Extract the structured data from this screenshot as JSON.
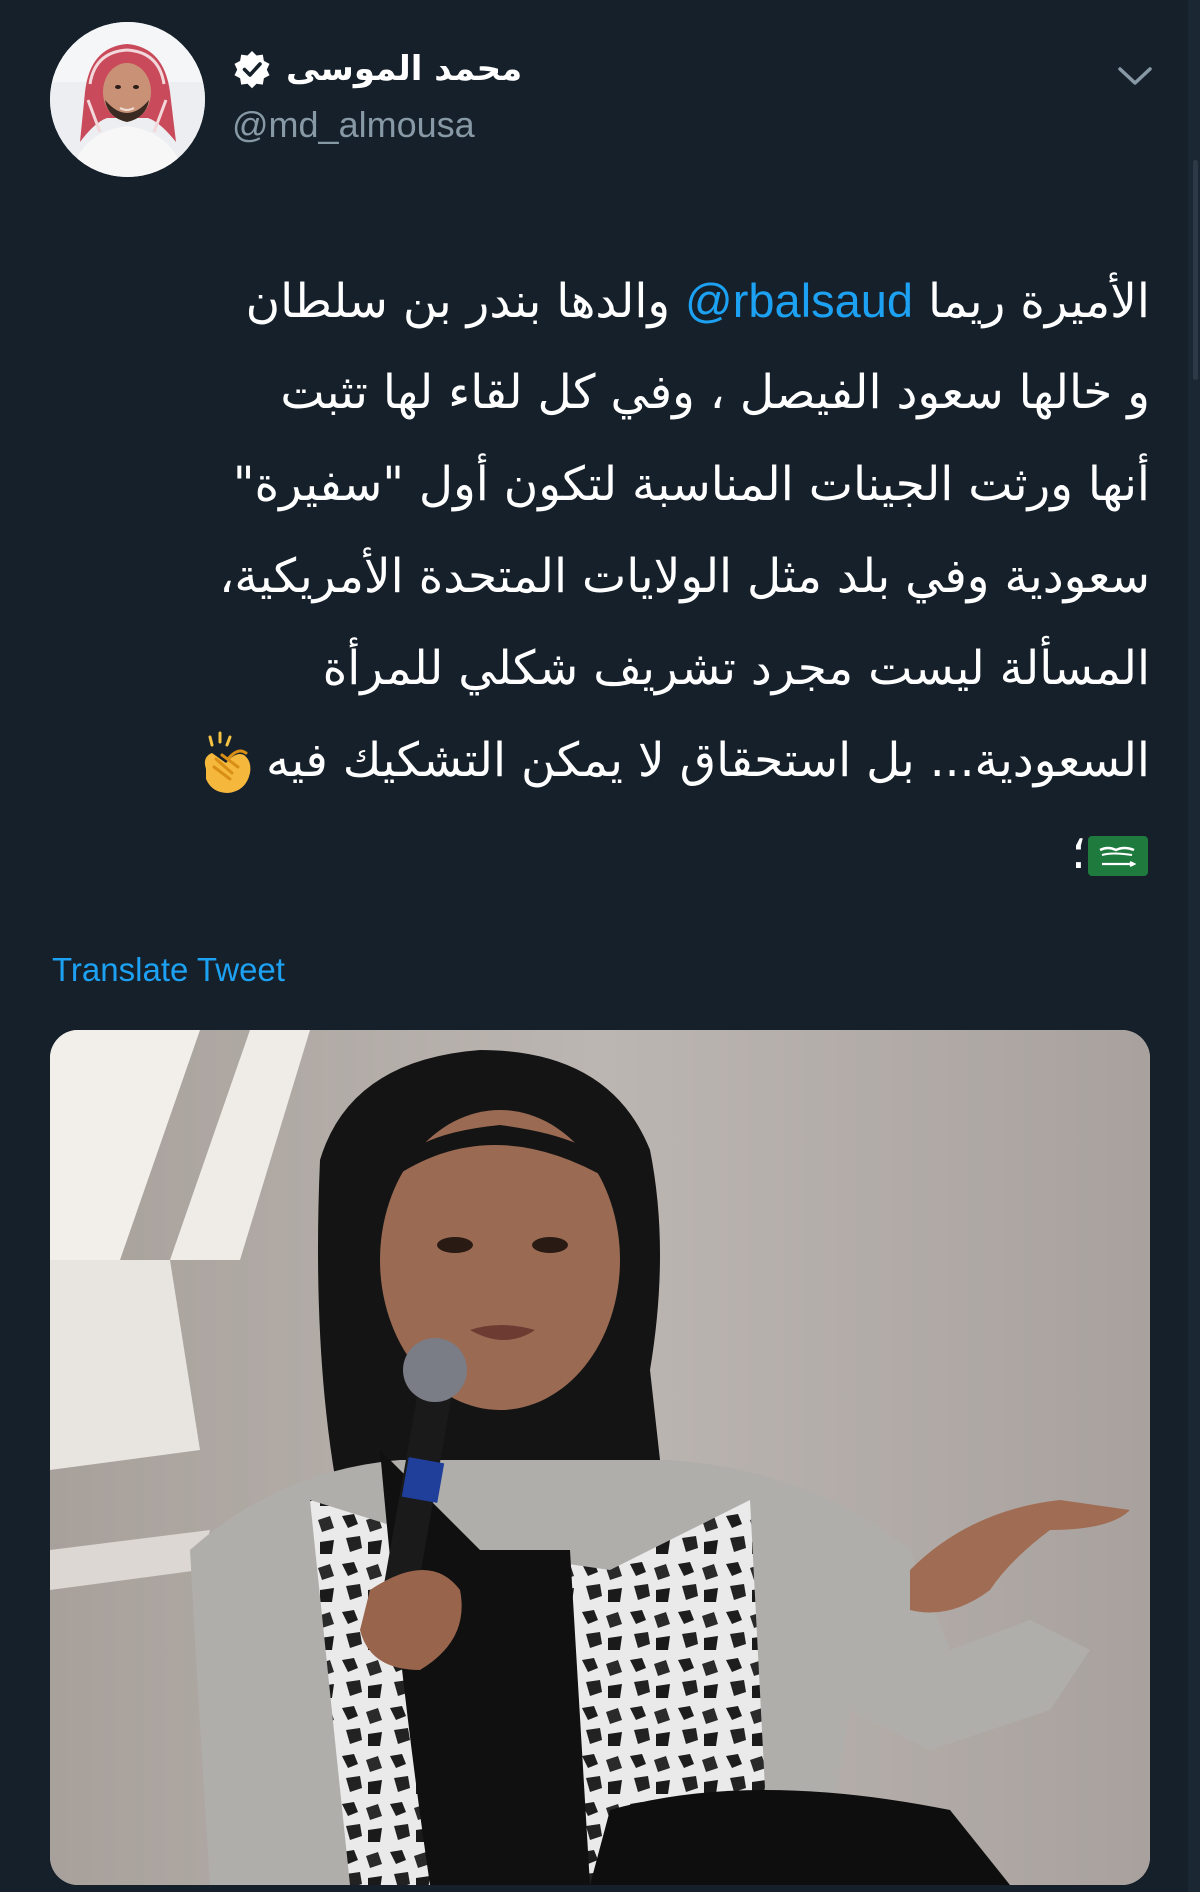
{
  "tweet": {
    "author": {
      "display_name": "محمد الموسى",
      "handle": "@md_almousa",
      "verified_icon": "verified-badge-icon"
    },
    "menu_icon": "chevron-down-icon",
    "text": {
      "line1_before": "الأميرة ريما ",
      "mention": "@rbalsaud",
      "line1_after": " والدها بندر بن سلطان",
      "line2": "و خالها سعود الفيصل ، وفي كل لقاء لها تثبت",
      "line3": "أنها ورثت الجينات المناسبة لتكون أول \"سفيرة\"",
      "line4": "سعودية وفي بلد مثل الولايات المتحدة الأمريكية،",
      "line5": "المسألة ليست مجرد تشريف شكلي للمرأة",
      "line6": "السعودية... بل استحقاق لا يمكن التشكيك فيه",
      "line7_suffix": "؛",
      "emojis": [
        "clapping-hands-icon",
        "saudi-flag-icon"
      ]
    },
    "translate_label": "Translate Tweet",
    "media": {
      "type": "photo",
      "icon": "photo-woman-speaking-microphone"
    }
  },
  "colors": {
    "background": "#15202b",
    "text_primary": "#ffffff",
    "text_secondary": "#8899a6",
    "accent": "#1da1f2",
    "verified_badge": "#ffffff"
  }
}
